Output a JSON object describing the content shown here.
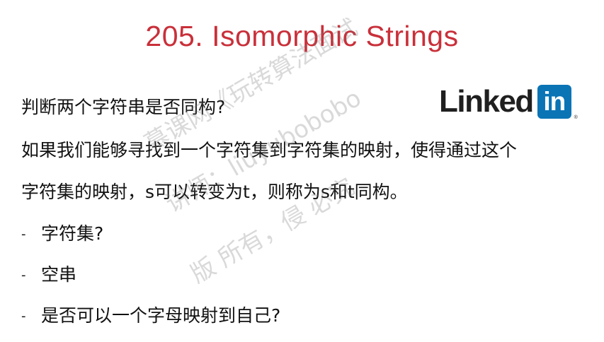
{
  "title": "205. Isomorphic Strings",
  "logo": {
    "word": "Linked",
    "box": "in",
    "tm": "®",
    "brand_color": "#0a74b5"
  },
  "lines": [
    "判断两个字符串是否同构?",
    "如果我们能够寻找到一个字符集到字符集的映射，使得通过这个",
    "字符集的映射，s可以转变为t，则称为s和t同构。"
  ],
  "bullets": [
    {
      "dash": "-",
      "text": "字符集?"
    },
    {
      "dash": "-",
      "text": "空串"
    },
    {
      "dash": "-",
      "text": "是否可以一个字母映射到自己?"
    }
  ],
  "watermarks": [
    "慕课网《玩转算法面试",
    "讲师：liuyubobobo",
    "版  所有，侵  必究"
  ],
  "colors": {
    "title": "#c9303a",
    "text": "#111111"
  }
}
